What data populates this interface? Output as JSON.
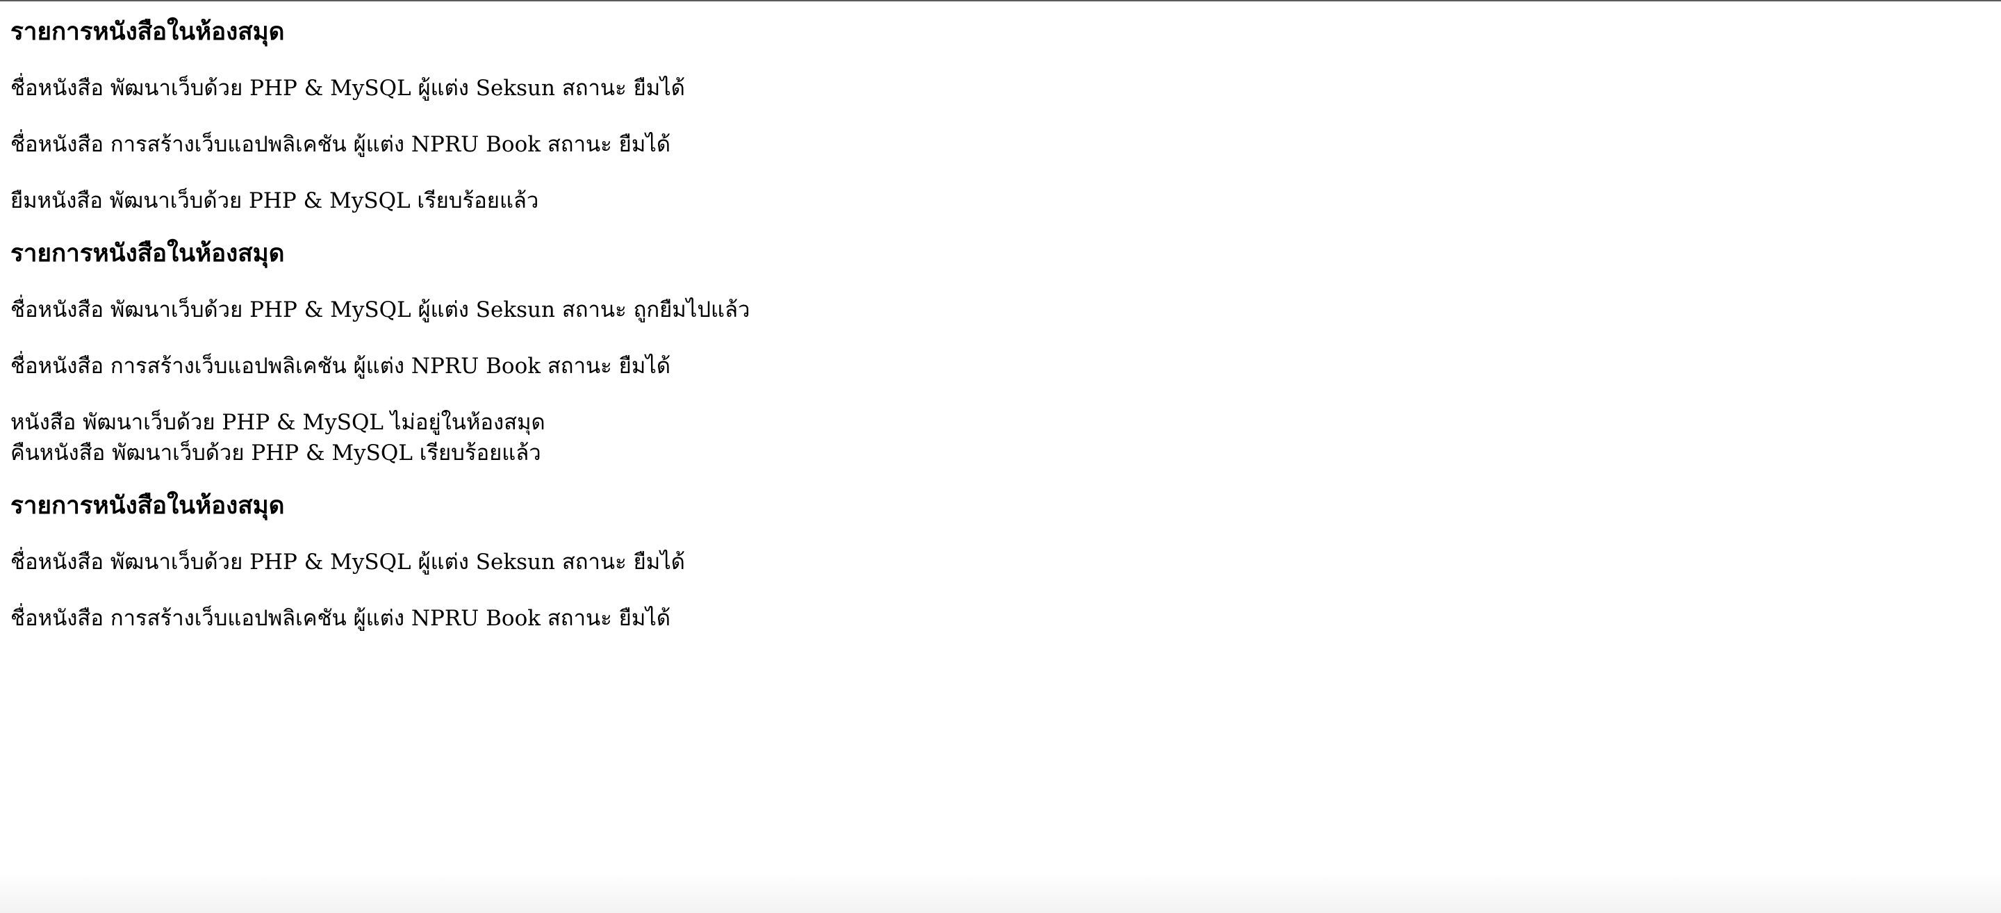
{
  "sections": [
    {
      "heading": "รายการหนังสือในห้องสมุด",
      "books": [
        "ชื่อหนังสือ พัฒนาเว็บด้วย PHP & MySQL ผู้แต่ง Seksun สถานะ ยืมได้",
        "ชื่อหนังสือ การสร้างเว็บแอปพลิเคชัน ผู้แต่ง NPRU Book สถานะ ยืมได้"
      ],
      "messages": [
        "ยืมหนังสือ พัฒนาเว็บด้วย PHP & MySQL เรียบร้อยแล้ว"
      ]
    },
    {
      "heading": "รายการหนังสือในห้องสมุด",
      "books": [
        "ชื่อหนังสือ พัฒนาเว็บด้วย PHP & MySQL ผู้แต่ง Seksun สถานะ ถูกยืมไปแล้ว",
        "ชื่อหนังสือ การสร้างเว็บแอปพลิเคชัน ผู้แต่ง NPRU Book สถานะ ยืมได้"
      ],
      "messages": [
        "หนังสือ พัฒนาเว็บด้วย PHP & MySQL ไม่อยู่ในห้องสมุด",
        "คืนหนังสือ พัฒนาเว็บด้วย PHP & MySQL เรียบร้อยแล้ว"
      ]
    },
    {
      "heading": "รายการหนังสือในห้องสมุด",
      "books": [
        "ชื่อหนังสือ พัฒนาเว็บด้วย PHP & MySQL ผู้แต่ง Seksun สถานะ ยืมได้",
        "ชื่อหนังสือ การสร้างเว็บแอปพลิเคชัน ผู้แต่ง NPRU Book สถานะ ยืมได้"
      ],
      "messages": []
    }
  ]
}
